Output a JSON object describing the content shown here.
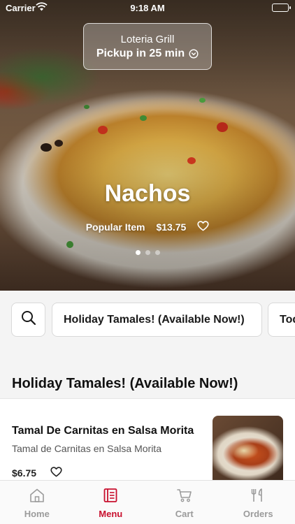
{
  "status_bar": {
    "carrier": "Carrier",
    "time": "9:18 AM"
  },
  "pickup": {
    "restaurant": "Loteria Grill",
    "eta": "Pickup in 25 min"
  },
  "hero": {
    "title": "Nachos",
    "badge": "Popular Item",
    "price": "$13.75",
    "page_count": 3,
    "active_page": 1
  },
  "categories": {
    "search_icon": "search-icon",
    "chips": [
      "Holiday Tamales! (Available Now!)",
      "Tod"
    ]
  },
  "section": {
    "title": "Holiday Tamales! (Available Now!)"
  },
  "item": {
    "title": "Tamal De Carnitas en Salsa Morita",
    "description": "Tamal de Carnitas en Salsa Morita",
    "price": "$6.75"
  },
  "tabs": [
    {
      "label": "Home",
      "icon": "home-icon",
      "active": false
    },
    {
      "label": "Menu",
      "icon": "menu-icon",
      "active": true
    },
    {
      "label": "Cart",
      "icon": "cart-icon",
      "active": false
    },
    {
      "label": "Orders",
      "icon": "orders-icon",
      "active": false
    }
  ],
  "colors": {
    "accent": "#c8102e",
    "inactive": "#9b9b9b",
    "background": "#f4f4f4"
  }
}
